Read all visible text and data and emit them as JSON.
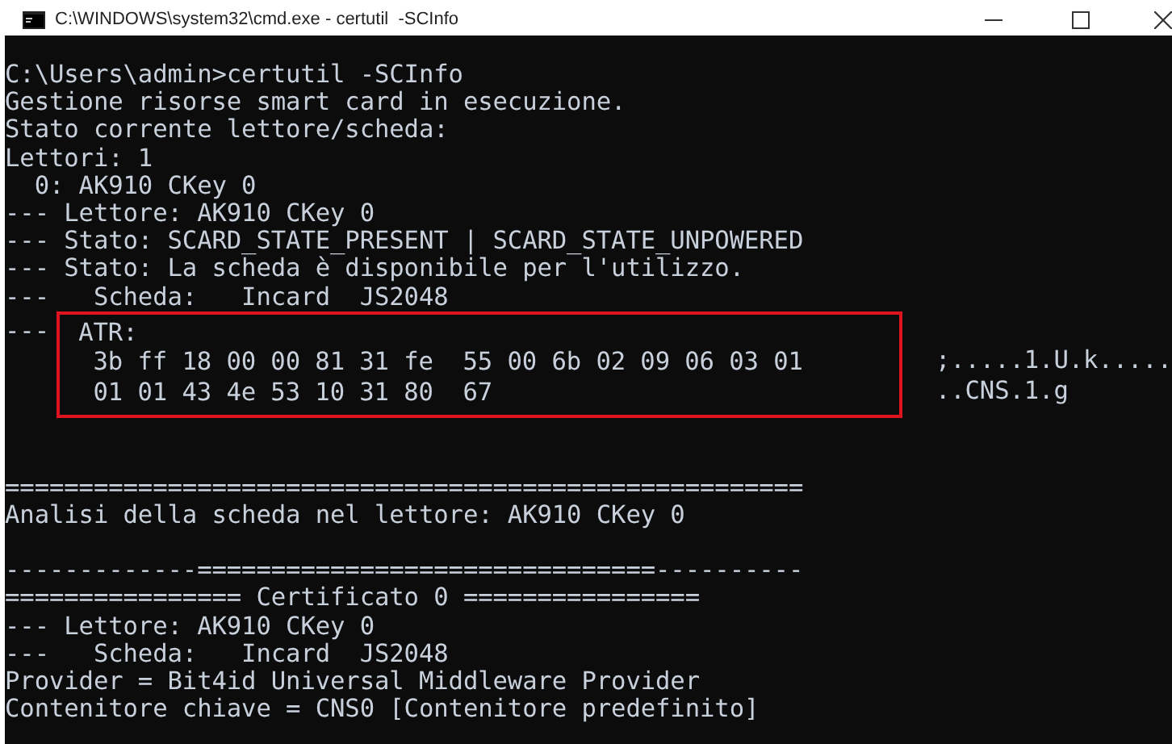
{
  "window": {
    "title": "C:\\WINDOWS\\system32\\cmd.exe - certutil  -SCInfo"
  },
  "lines": [
    {
      "kind": "text",
      "text": "C:\\Users\\admin>certutil -SCInfo"
    },
    {
      "kind": "text",
      "text": "Gestione risorse smart card in esecuzione."
    },
    {
      "kind": "text",
      "text": "Stato corrente lettore/scheda:"
    },
    {
      "kind": "text",
      "text": "Lettori: 1"
    },
    {
      "kind": "text",
      "text": "  0: AK910 CKey 0"
    },
    {
      "kind": "text",
      "text": "--- Lettore: AK910 CKey 0"
    },
    {
      "kind": "text",
      "text": "--- Stato: SCARD_STATE_PRESENT | SCARD_STATE_UNPOWERED"
    },
    {
      "kind": "text",
      "text": "--- Stato: La scheda è disponibile per l'utilizzo."
    },
    {
      "kind": "text",
      "text": "---   Scheda:   Incard  JS2048"
    },
    {
      "kind": "highlight",
      "rows": [
        {
          "prefix": "---",
          "text": "ATR:"
        },
        {
          "text": " 3b ff 18 00 00 81 31 fe  55 00 6b 02 09 06 03 01",
          "aside": ";.....1.U.k....."
        },
        {
          "text": " 01 01 43 4e 53 10 31 80  67",
          "aside": "..CNS.1.g"
        }
      ]
    },
    {
      "kind": "blank"
    },
    {
      "kind": "blank"
    },
    {
      "kind": "text",
      "text": "======================================================"
    },
    {
      "kind": "text",
      "text": "Analisi della scheda nel lettore: AK910 CKey 0"
    },
    {
      "kind": "blank"
    },
    {
      "kind": "text",
      "text": "-------------===============================----------"
    },
    {
      "kind": "text",
      "text": "================ Certificato 0 ================"
    },
    {
      "kind": "text",
      "text": "--- Lettore: AK910 CKey 0"
    },
    {
      "kind": "text",
      "text": "---   Scheda:   Incard  JS2048"
    },
    {
      "kind": "text",
      "text": "Provider = Bit4id Universal Middleware Provider"
    },
    {
      "kind": "text",
      "text": "Contenitore chiave = CNS0 [Contenitore predefinito]"
    }
  ]
}
